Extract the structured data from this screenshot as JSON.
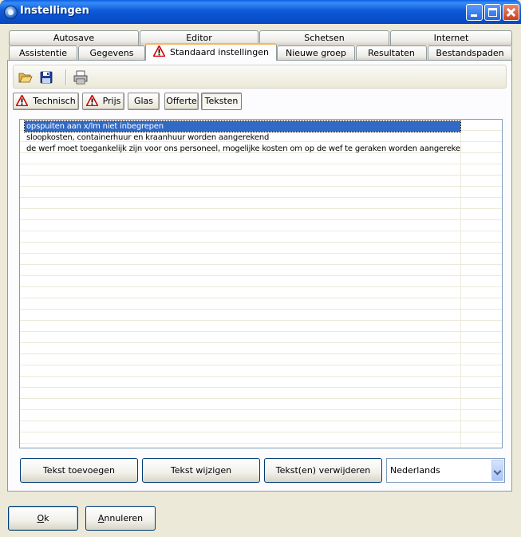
{
  "window": {
    "title": "Instellingen"
  },
  "tabs_row1": [
    {
      "label": "Autosave"
    },
    {
      "label": "Editor"
    },
    {
      "label": "Schetsen"
    },
    {
      "label": "Internet"
    }
  ],
  "tabs_row2": [
    {
      "label": "Assistentie"
    },
    {
      "label": "Gegevens"
    },
    {
      "label": "Standaard instellingen",
      "active": true
    },
    {
      "label": "Nieuwe groep"
    },
    {
      "label": "Resultaten"
    },
    {
      "label": "Bestandspaden"
    }
  ],
  "subtabs": [
    {
      "label": "Technisch",
      "warning": true
    },
    {
      "label": "Prijs",
      "warning": true
    },
    {
      "label": "Glas"
    },
    {
      "label": "Offerte"
    },
    {
      "label": "Teksten",
      "active": true
    }
  ],
  "texts": [
    "opspuiten aan x/lm niet inbegrepen",
    "sloopkosten, containerhuur en kraanhuur worden aangerekend",
    "de werf moet toegankelijk zijn voor ons personeel, mogelijke kosten om op de wef te geraken worden aangerekend"
  ],
  "buttons": {
    "add": "Tekst toevoegen",
    "edit": "Tekst wijzigen",
    "delete": "Tekst(en) verwijderen"
  },
  "language": {
    "selected": "Nederlands"
  },
  "dialog": {
    "ok_mnemonic": "O",
    "ok_rest": "k",
    "cancel_mnemonic": "A",
    "cancel_rest": "nnuleren"
  },
  "icons": {
    "open": "folder-open-icon",
    "save": "floppy-disk-icon",
    "print": "printer-icon",
    "warning": "warning-triangle-icon"
  },
  "colors": {
    "title_bar": "#0a5fe6",
    "selection": "#316ac5",
    "active_tab_accent": "#f4b85a",
    "warning_red": "#d40000"
  }
}
